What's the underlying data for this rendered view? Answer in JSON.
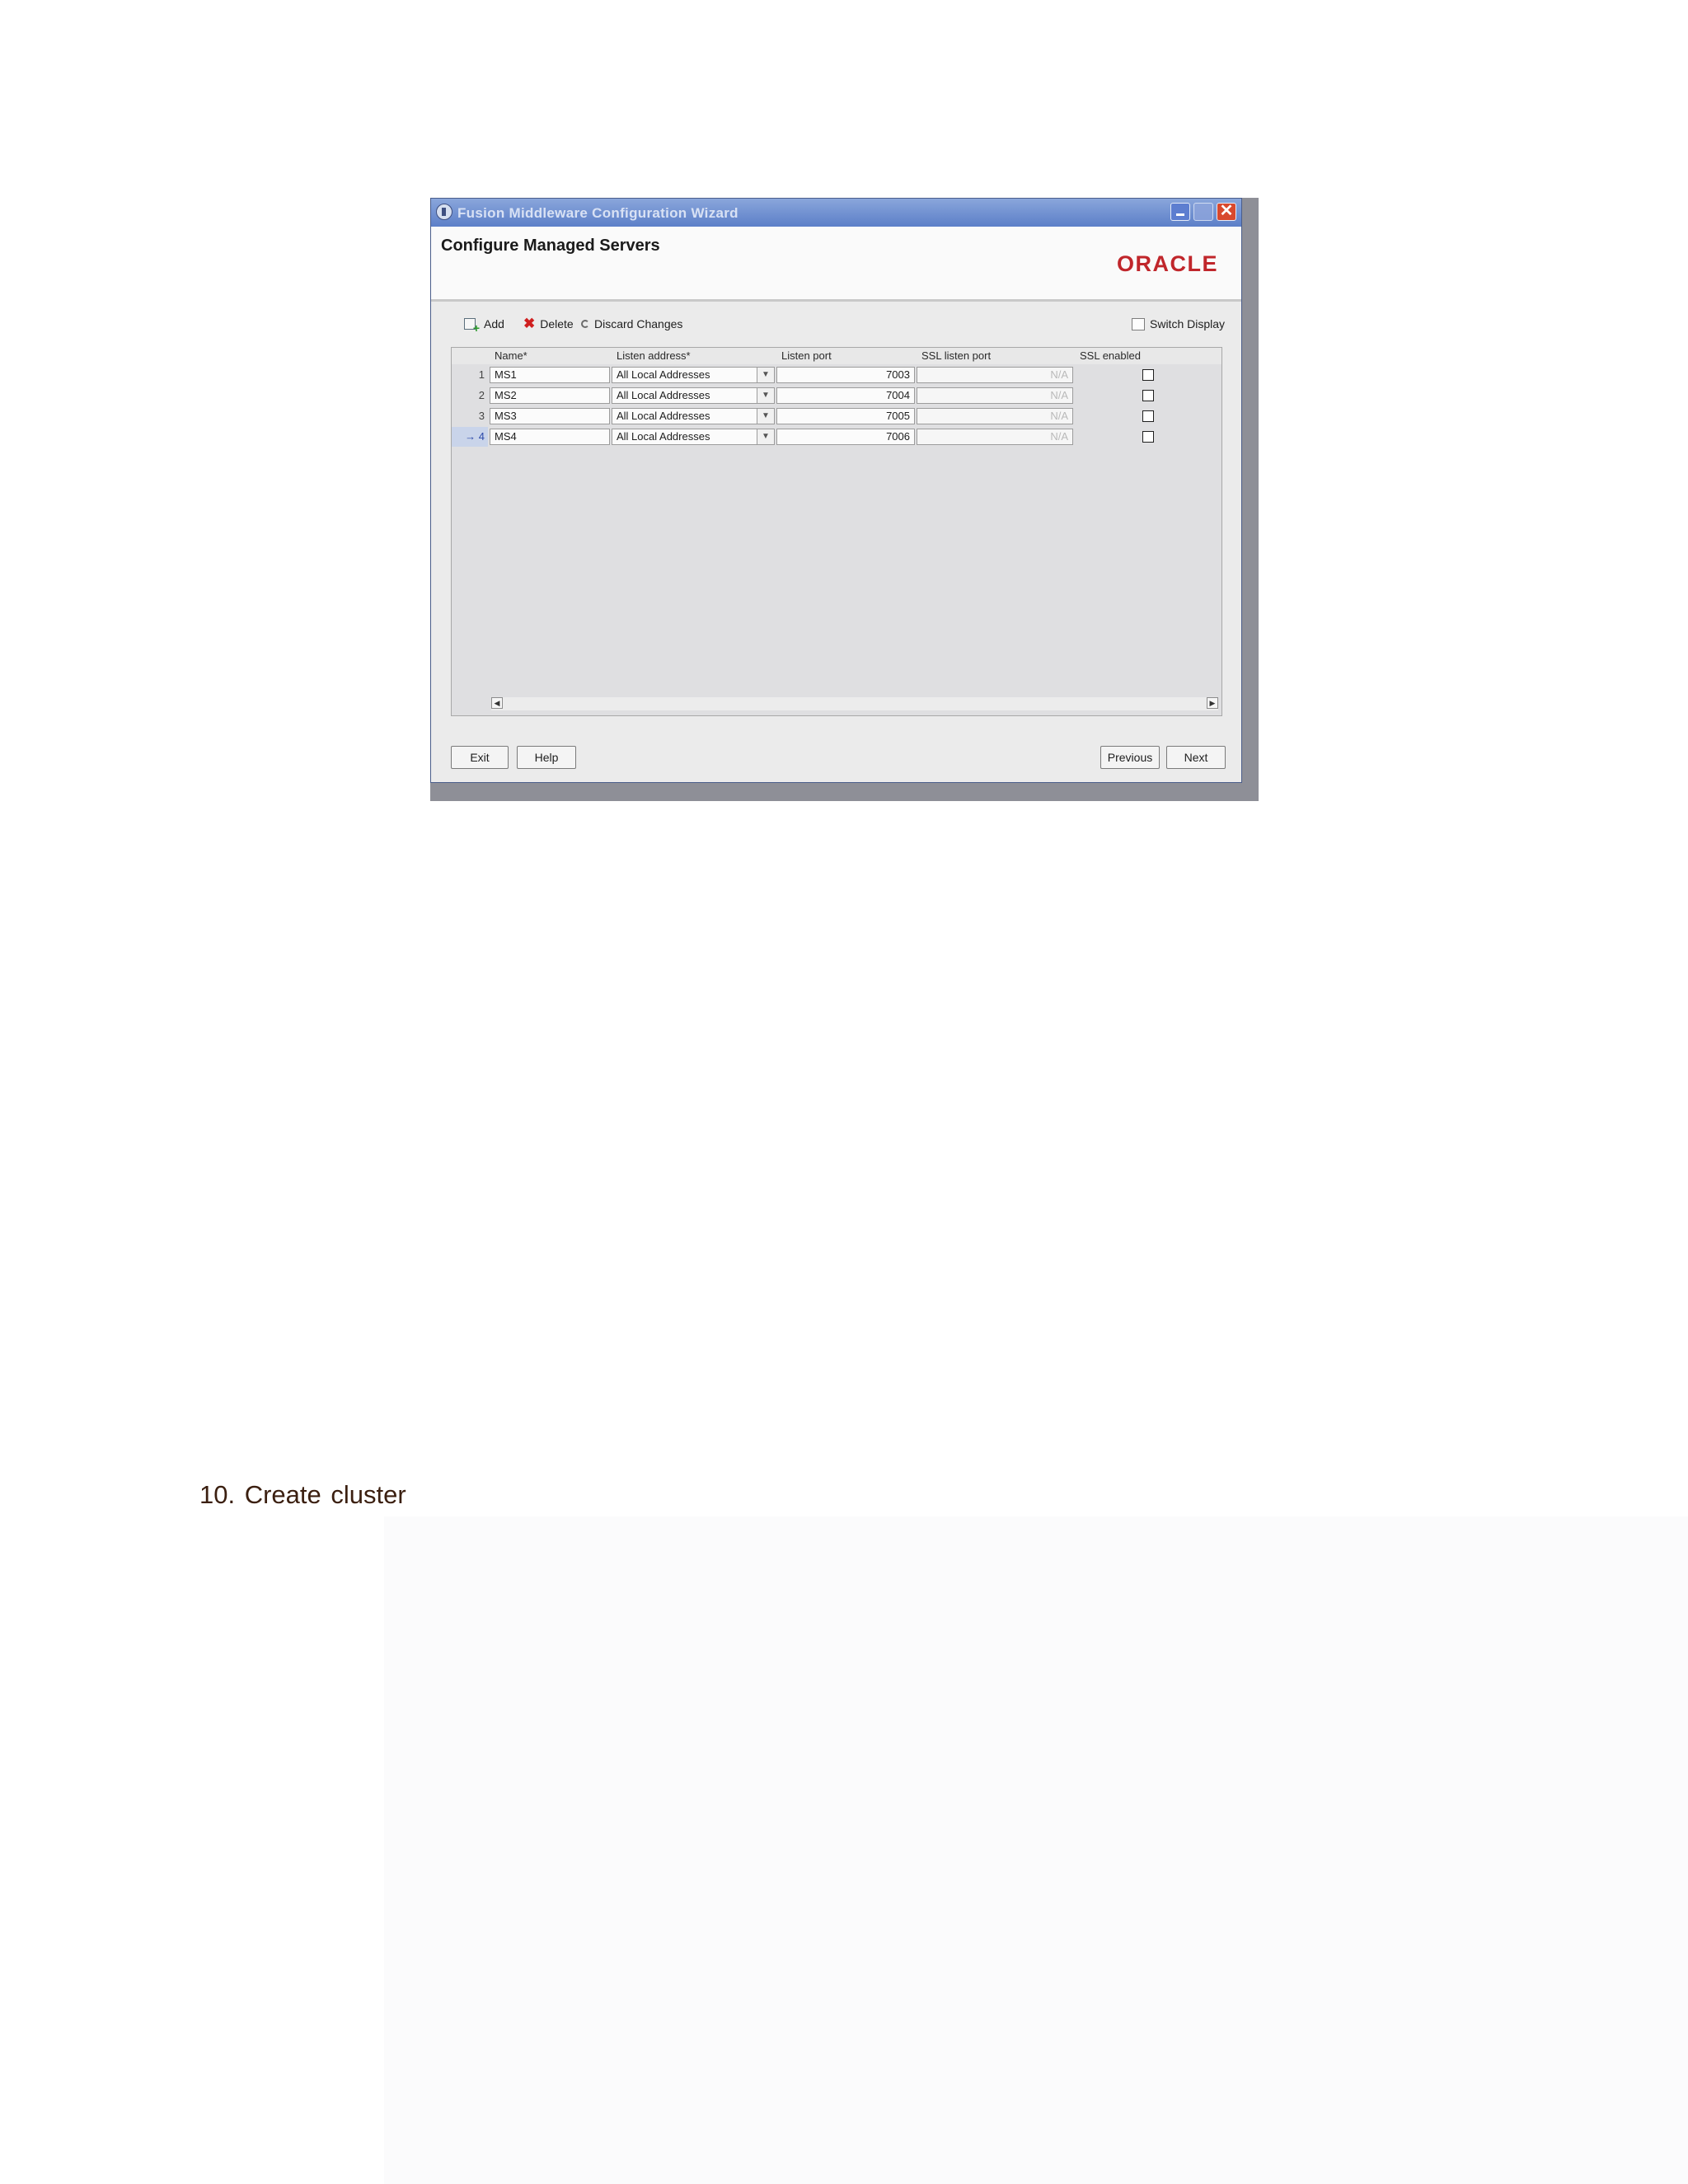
{
  "window": {
    "title": "Fusion Middleware Configuration Wizard",
    "close_glyph": "✕"
  },
  "header": {
    "page_title": "Configure Managed Servers",
    "logo": "ORACLE"
  },
  "toolbar": {
    "add": "Add",
    "delete": "Delete",
    "discard": "Discard Changes",
    "switch_display": "Switch Display"
  },
  "table": {
    "columns": [
      "Name*",
      "Listen address*",
      "Listen port",
      "SSL listen port",
      "SSL enabled"
    ],
    "rows": [
      {
        "num": "1",
        "name": "MS1",
        "address": "All Local Addresses",
        "port": "7003",
        "ssl_port": "N/A",
        "ssl_enabled": false
      },
      {
        "num": "2",
        "name": "MS2",
        "address": "All Local Addresses",
        "port": "7004",
        "ssl_port": "N/A",
        "ssl_enabled": false
      },
      {
        "num": "3",
        "name": "MS3",
        "address": "All Local Addresses",
        "port": "7005",
        "ssl_port": "N/A",
        "ssl_enabled": false
      },
      {
        "num": "→ 4",
        "name": "MS4",
        "address": "All Local Addresses",
        "port": "7006",
        "ssl_port": "N/A",
        "ssl_enabled": false
      }
    ],
    "current_row": 4
  },
  "footer": {
    "exit": "Exit",
    "help": "Help",
    "previous": "Previous",
    "next": "Next"
  },
  "caption": "10. Create cluster",
  "colors": {
    "oracle_red": "#c0262b",
    "titlebar_blue": "#5c7fc8"
  }
}
